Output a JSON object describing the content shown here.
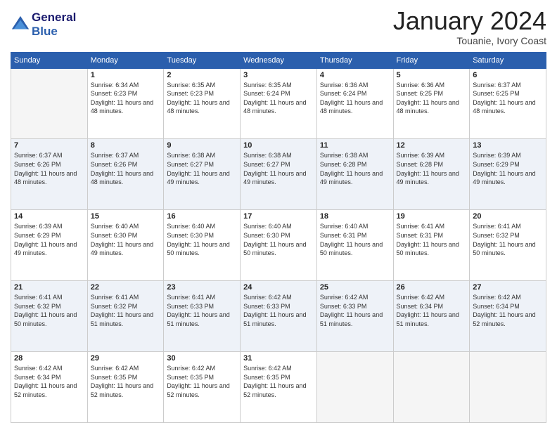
{
  "logo": {
    "line1": "General",
    "line2": "Blue"
  },
  "header": {
    "month": "January 2024",
    "location": "Touanie, Ivory Coast"
  },
  "weekdays": [
    "Sunday",
    "Monday",
    "Tuesday",
    "Wednesday",
    "Thursday",
    "Friday",
    "Saturday"
  ],
  "days": [
    {
      "num": "",
      "empty": true
    },
    {
      "num": "1",
      "sunrise": "6:34 AM",
      "sunset": "6:23 PM",
      "daylight": "11 hours and 48 minutes."
    },
    {
      "num": "2",
      "sunrise": "6:35 AM",
      "sunset": "6:23 PM",
      "daylight": "11 hours and 48 minutes."
    },
    {
      "num": "3",
      "sunrise": "6:35 AM",
      "sunset": "6:24 PM",
      "daylight": "11 hours and 48 minutes."
    },
    {
      "num": "4",
      "sunrise": "6:36 AM",
      "sunset": "6:24 PM",
      "daylight": "11 hours and 48 minutes."
    },
    {
      "num": "5",
      "sunrise": "6:36 AM",
      "sunset": "6:25 PM",
      "daylight": "11 hours and 48 minutes."
    },
    {
      "num": "6",
      "sunrise": "6:37 AM",
      "sunset": "6:25 PM",
      "daylight": "11 hours and 48 minutes."
    },
    {
      "num": "7",
      "sunrise": "6:37 AM",
      "sunset": "6:26 PM",
      "daylight": "11 hours and 48 minutes."
    },
    {
      "num": "8",
      "sunrise": "6:37 AM",
      "sunset": "6:26 PM",
      "daylight": "11 hours and 48 minutes."
    },
    {
      "num": "9",
      "sunrise": "6:38 AM",
      "sunset": "6:27 PM",
      "daylight": "11 hours and 49 minutes."
    },
    {
      "num": "10",
      "sunrise": "6:38 AM",
      "sunset": "6:27 PM",
      "daylight": "11 hours and 49 minutes."
    },
    {
      "num": "11",
      "sunrise": "6:38 AM",
      "sunset": "6:28 PM",
      "daylight": "11 hours and 49 minutes."
    },
    {
      "num": "12",
      "sunrise": "6:39 AM",
      "sunset": "6:28 PM",
      "daylight": "11 hours and 49 minutes."
    },
    {
      "num": "13",
      "sunrise": "6:39 AM",
      "sunset": "6:29 PM",
      "daylight": "11 hours and 49 minutes."
    },
    {
      "num": "14",
      "sunrise": "6:39 AM",
      "sunset": "6:29 PM",
      "daylight": "11 hours and 49 minutes."
    },
    {
      "num": "15",
      "sunrise": "6:40 AM",
      "sunset": "6:30 PM",
      "daylight": "11 hours and 49 minutes."
    },
    {
      "num": "16",
      "sunrise": "6:40 AM",
      "sunset": "6:30 PM",
      "daylight": "11 hours and 50 minutes."
    },
    {
      "num": "17",
      "sunrise": "6:40 AM",
      "sunset": "6:30 PM",
      "daylight": "11 hours and 50 minutes."
    },
    {
      "num": "18",
      "sunrise": "6:40 AM",
      "sunset": "6:31 PM",
      "daylight": "11 hours and 50 minutes."
    },
    {
      "num": "19",
      "sunrise": "6:41 AM",
      "sunset": "6:31 PM",
      "daylight": "11 hours and 50 minutes."
    },
    {
      "num": "20",
      "sunrise": "6:41 AM",
      "sunset": "6:32 PM",
      "daylight": "11 hours and 50 minutes."
    },
    {
      "num": "21",
      "sunrise": "6:41 AM",
      "sunset": "6:32 PM",
      "daylight": "11 hours and 50 minutes."
    },
    {
      "num": "22",
      "sunrise": "6:41 AM",
      "sunset": "6:32 PM",
      "daylight": "11 hours and 51 minutes."
    },
    {
      "num": "23",
      "sunrise": "6:41 AM",
      "sunset": "6:33 PM",
      "daylight": "11 hours and 51 minutes."
    },
    {
      "num": "24",
      "sunrise": "6:42 AM",
      "sunset": "6:33 PM",
      "daylight": "11 hours and 51 minutes."
    },
    {
      "num": "25",
      "sunrise": "6:42 AM",
      "sunset": "6:33 PM",
      "daylight": "11 hours and 51 minutes."
    },
    {
      "num": "26",
      "sunrise": "6:42 AM",
      "sunset": "6:34 PM",
      "daylight": "11 hours and 51 minutes."
    },
    {
      "num": "27",
      "sunrise": "6:42 AM",
      "sunset": "6:34 PM",
      "daylight": "11 hours and 52 minutes."
    },
    {
      "num": "28",
      "sunrise": "6:42 AM",
      "sunset": "6:34 PM",
      "daylight": "11 hours and 52 minutes."
    },
    {
      "num": "29",
      "sunrise": "6:42 AM",
      "sunset": "6:35 PM",
      "daylight": "11 hours and 52 minutes."
    },
    {
      "num": "30",
      "sunrise": "6:42 AM",
      "sunset": "6:35 PM",
      "daylight": "11 hours and 52 minutes."
    },
    {
      "num": "31",
      "sunrise": "6:42 AM",
      "sunset": "6:35 PM",
      "daylight": "11 hours and 52 minutes."
    },
    {
      "num": "",
      "empty": true
    },
    {
      "num": "",
      "empty": true
    },
    {
      "num": "",
      "empty": true
    },
    {
      "num": "",
      "empty": true
    }
  ],
  "labels": {
    "sunrise": "Sunrise:",
    "sunset": "Sunset:",
    "daylight": "Daylight:"
  }
}
